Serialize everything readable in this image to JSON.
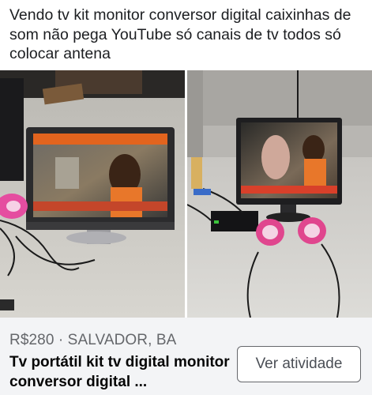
{
  "post": {
    "text": "Vendo tv kit monitor conversor digital caixinhas de som não pega YouTube só canais de tv todos só colocar antena"
  },
  "photos": [
    {
      "alt_name": "tv-kit-photo-left"
    },
    {
      "alt_name": "tv-kit-photo-right"
    }
  ],
  "listing": {
    "price_location": "R$280 · SALVADOR, BA",
    "title": "Tv portátil kit tv digital monitor conversor digital ...",
    "button_label": "Ver atividade"
  },
  "colors": {
    "listing_bg": "#f3f4f6",
    "secondary_text": "#65676b",
    "primary_text": "#050505"
  }
}
